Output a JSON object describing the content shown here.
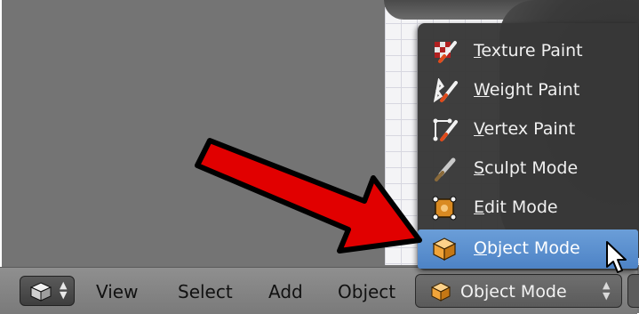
{
  "header": {
    "menus": [
      {
        "label": "View"
      },
      {
        "label": "Select"
      },
      {
        "label": "Add"
      },
      {
        "label": "Object"
      }
    ],
    "mode_select": {
      "label": "Object Mode",
      "icon": "object-cube-icon"
    },
    "editor_type_icon": "3d-view-cube-icon"
  },
  "mode_menu": {
    "items": [
      {
        "label_first": "T",
        "label_rest": "exture Paint",
        "icon": "texture-paint-icon",
        "active": false
      },
      {
        "label_first": "W",
        "label_rest": "eight Paint",
        "icon": "weight-paint-icon",
        "active": false
      },
      {
        "label_first": "V",
        "label_rest": "ertex Paint",
        "icon": "vertex-paint-icon",
        "active": false
      },
      {
        "label_first": "S",
        "label_rest": "culpt Mode",
        "icon": "sculpt-mode-icon",
        "active": false
      },
      {
        "label_first": "E",
        "label_rest": "dit Mode",
        "icon": "edit-mode-icon",
        "active": false
      },
      {
        "label_first": "O",
        "label_rest": "bject Mode",
        "icon": "object-mode-icon",
        "active": true
      }
    ]
  },
  "annotation": {
    "arrow_color": "#e10000",
    "arrow_outline": "#000000"
  },
  "colors": {
    "menu_bg": "#383838",
    "active_item": "#5b8fd0",
    "header_bg": "#848484",
    "viewport_bg": "#747474"
  }
}
